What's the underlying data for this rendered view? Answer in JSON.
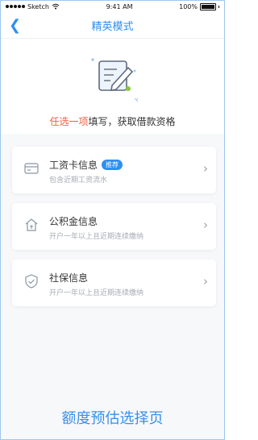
{
  "status_bar": {
    "carrier": "Sketch",
    "time": "9:41 AM",
    "battery": "100%"
  },
  "nav": {
    "title": "精英模式"
  },
  "hero": {
    "highlight": "任选一项",
    "rest": "填写，获取借款资格"
  },
  "cards": [
    {
      "title": "工资卡信息",
      "badge": "推荐",
      "subtitle": "包含近期工资流水"
    },
    {
      "title": "公积金信息",
      "subtitle": "开户一年以上且近期连续缴纳"
    },
    {
      "title": "社保信息",
      "subtitle": "开户一年以上且近期连续缴纳"
    }
  ],
  "footer": {
    "caption": "额度预估选择页"
  },
  "colors": {
    "accent": "#2e8ff2",
    "highlight": "#f45b3e"
  }
}
